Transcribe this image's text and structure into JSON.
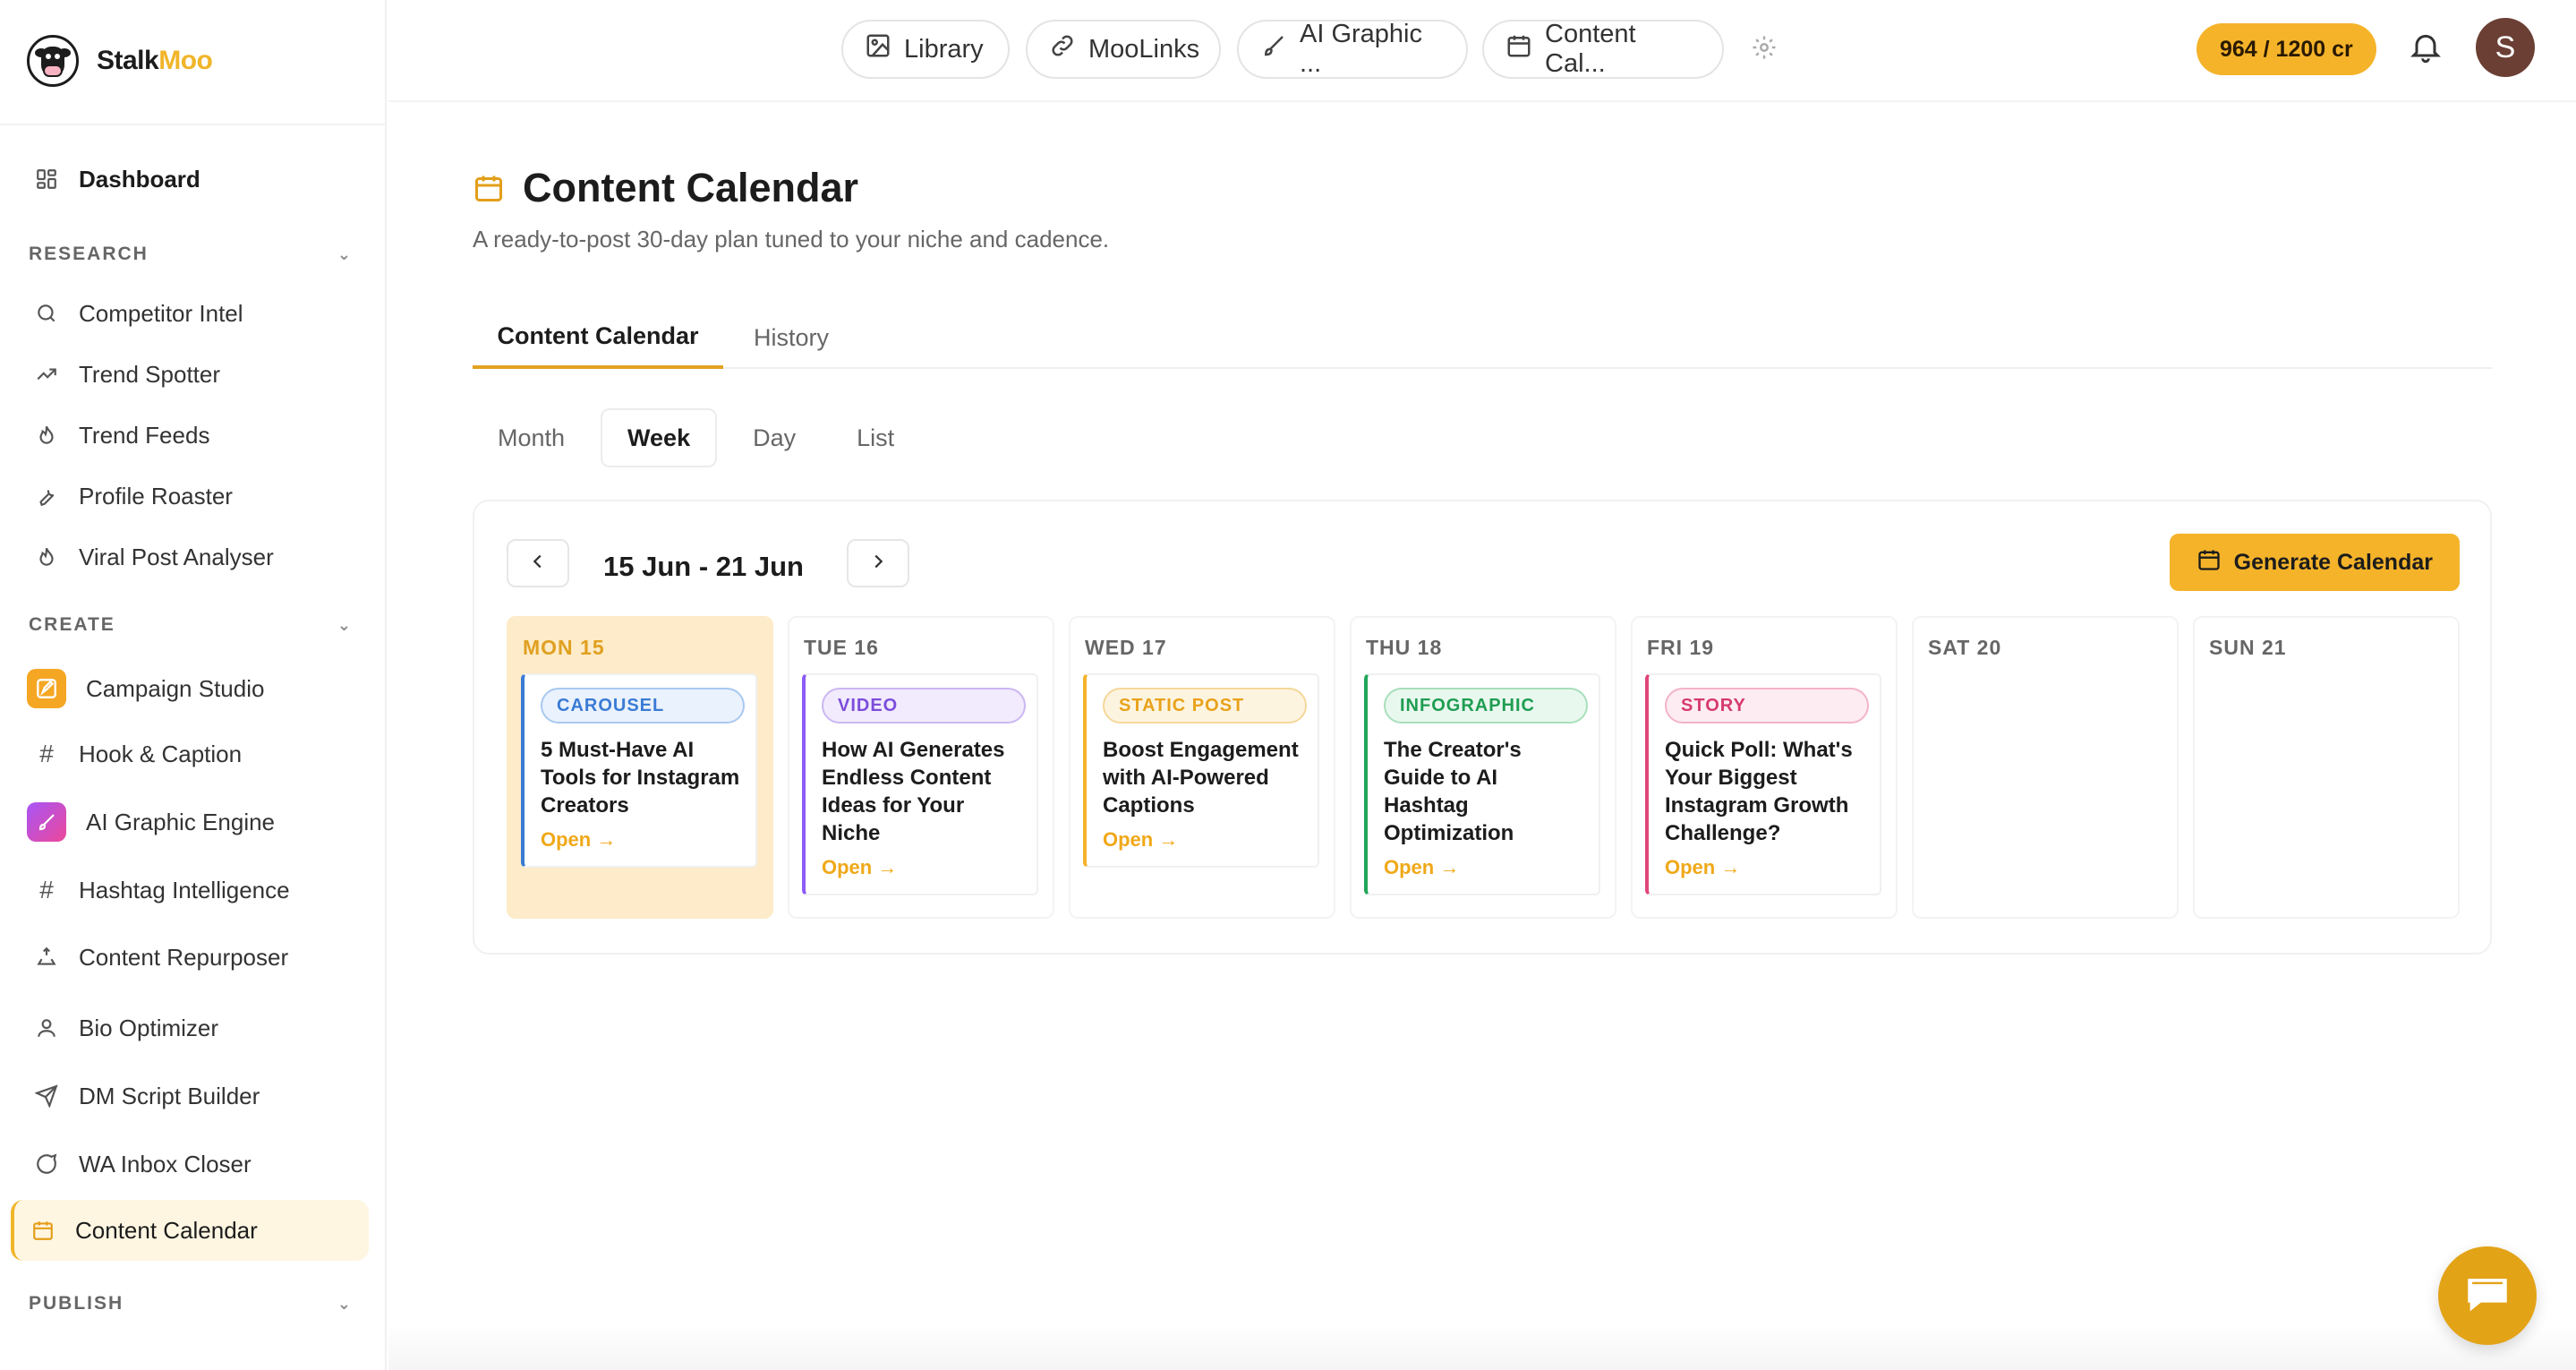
{
  "brand": {
    "name_part1": "Stalk",
    "name_part2": "Moo"
  },
  "sidebar": {
    "dashboard": "Dashboard",
    "research": {
      "heading": "RESEARCH",
      "items": [
        "Competitor Intel",
        "Trend Spotter",
        "Trend Feeds",
        "Profile Roaster",
        "Viral Post Analyser"
      ]
    },
    "create": {
      "heading": "CREATE",
      "items": [
        "Campaign Studio",
        "Hook & Caption",
        "AI Graphic Engine",
        "Hashtag Intelligence",
        "Content Repurposer",
        "Bio Optimizer",
        "DM Script Builder",
        "WA Inbox Closer",
        "Content Calendar"
      ],
      "active": "Content Calendar"
    },
    "publish": {
      "heading": "PUBLISH"
    }
  },
  "topbar": {
    "pills": [
      "Library",
      "MooLinks",
      "AI Graphic ...",
      "Content Cal..."
    ],
    "credits": "964 / 1200 cr",
    "avatar_initial": "S"
  },
  "page": {
    "title": "Content Calendar",
    "subtitle": "A ready-to-post 30-day plan tuned to your niche and cadence.",
    "tabs": [
      "Content Calendar",
      "History"
    ],
    "active_tab": "Content Calendar",
    "views": [
      "Month",
      "Week",
      "Day",
      "List"
    ],
    "active_view": "Week"
  },
  "calendar": {
    "range": "15 Jun - 21 Jun",
    "generate_label": "Generate Calendar",
    "open_label": "Open →",
    "days": [
      {
        "label": "MON 15",
        "today": true,
        "post": {
          "type": "CAROUSEL",
          "title": "5 Must-Have AI Tools for Instagram Creators"
        }
      },
      {
        "label": "TUE 16",
        "post": {
          "type": "VIDEO",
          "title": "How AI Generates Endless Content Ideas for Your Niche"
        }
      },
      {
        "label": "WED 17",
        "post": {
          "type": "STATIC POST",
          "title": "Boost Engagement with AI-Powered Captions"
        }
      },
      {
        "label": "THU 18",
        "post": {
          "type": "INFOGRAPHIC",
          "title": "The Creator's Guide to AI Hashtag Optimization"
        }
      },
      {
        "label": "FRI 19",
        "post": {
          "type": "STORY",
          "title": "Quick Poll: What's Your Biggest Instagram Growth Challenge?"
        }
      },
      {
        "label": "SAT 20"
      },
      {
        "label": "SUN 21"
      }
    ]
  },
  "colors": {
    "accent": "#f5b32a",
    "carousel": "#3a7bd5",
    "video": "#8b5cf6",
    "static_post": "#f5b32a",
    "infographic": "#22a559",
    "story": "#e0457b"
  }
}
